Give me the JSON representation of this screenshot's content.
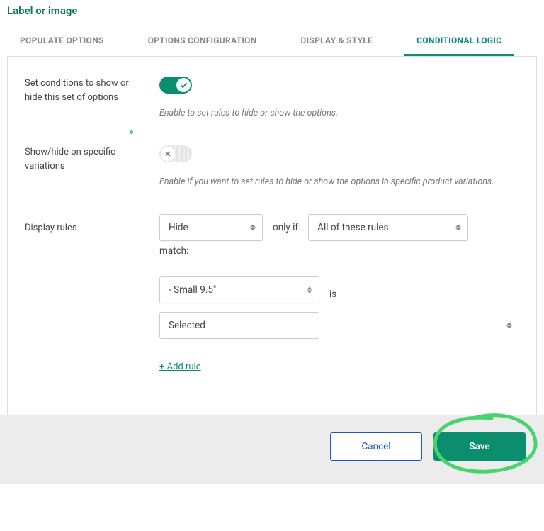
{
  "header": {
    "title": "Label or image"
  },
  "tabs": [
    {
      "label": "POPULATE OPTIONS",
      "active": false
    },
    {
      "label": "OPTIONS CONFIGURATION",
      "active": false
    },
    {
      "label": "DISPLAY & STYLE",
      "active": false
    },
    {
      "label": "CONDITIONAL LOGIC",
      "active": true
    }
  ],
  "section1": {
    "label": "Set conditions to show or hide this set of options",
    "enabled": true,
    "help": "Enable to set rules to hide or show the options."
  },
  "section2": {
    "label": "Show/hide on specific variations",
    "enabled": false,
    "help": "Enable if you want to set rules to hide or show the options in specific product variations."
  },
  "rules": {
    "label": "Display rules",
    "action": "Hide",
    "middle_text": "only if",
    "scope": "All of these rules",
    "match_text": "match:",
    "condition_option": "- Small 9.5\"",
    "condition_is_text": "is",
    "condition_state": "Selected",
    "add_rule": "+ Add rule"
  },
  "footer": {
    "cancel": "Cancel",
    "save": "Save"
  }
}
